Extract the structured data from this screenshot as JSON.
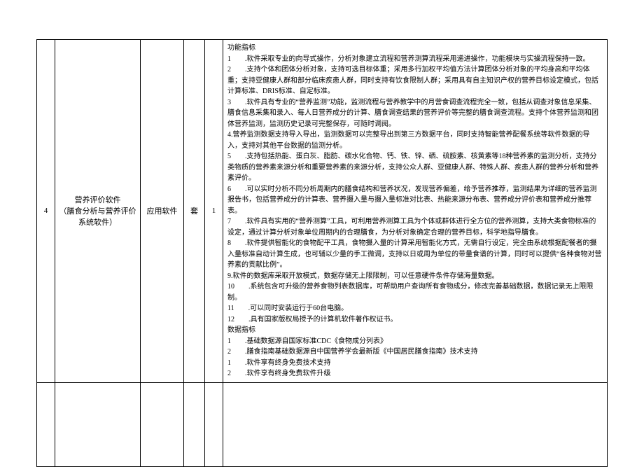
{
  "row": {
    "index": "4",
    "name": "营养评价软件\n（膳食分析与营养评价系统软件）",
    "type": "应用软件",
    "unit": "套",
    "qty": "1"
  },
  "details": {
    "funcTitle": "功能指标",
    "lines": [
      "1　　.软件采取专业的向导式操作，分析对象建立流程和营养测算流程采用递进操作，功能模块与实操流程保持一致。",
      "2　　.支持个体和团体分析对象，支持可选目标体重；采用多行加权平均值方法计算团体分析对象的平均身高和平均体重；支持亚健康人群和部分临床疾患人群，同时支持有饮食限制人群；采用具有自主知识产权的营养目标设定模式，包括计算标准、DRIS标准、自定标准。",
      "3　　.软件具有专业的“营养监测”功能，监测流程与营养教学中的月营食调查流程完全一致，包括从调查对象信息采集、膳食信息采集和录入、每人日营养成分的计算、膳食调查结果的营养评价等完整的膳食调查流程。支持个体营养监测和团体营养监测，监测历史记录可完整保存，可随时调阅。",
      "4.营养监测数据支持导入导出，监测数据可以完整导出到第三方数据平台，同时支持智能营养配餐系统等软件数据的导入，支持对其他平台数据的监测分析。",
      "5　　.支持包括热能、蛋白灰、脂肪、碳水化合物、钙、铁、锌、硒、硫胺素、核黄素等18种营养素的监测分析，支持分类物质的营养素来源分析和重要营养素的来源分析，支持公众人群、亚健康人群、特殊人群、疾患人群的营养分析和营养素评价。",
      "6　　.可以实时分析不同分析周期内的膳食结构和营养状况，发现营养偏差，给予营养推荐，监测结果为详细的营养监测报告书，包括营养成分的计算表、营养摄入量与摄入量标准对比表、热能来源分布表、营养成分评价表和营养成分推荐表。",
      "7　　.软件具有实用的“营养测算”工具，可利用营养测算工具为个体或群体进行全方位的营养测算，支持大类食物标准的设定，通过计算分析对象单位周期内的合理膳食，为分析对象确定合理的营养目标，科学地指导膳食。",
      "8　　.软件提供智能化的食物配平工具，食物摄入量的计算采用智能化方式，无需自行设定，完全由系统根据配餐者的摄入量标准自动计算生成，也可辅以少量的手工微调，支持以日或周为单位的带量食谱的计算，同时可以提供“各种食物对营养素的贡献比例”。",
      "9.软件的数据库采取开放模式，数据存储无上限限制，可以任意硬件条件存储海量数据。",
      "10　　.系统包含可升级的营养食物列表数据库，可帮助用户查询所有食物成分，修改完善基础数据，数据记录无上限限制。",
      "11　　.可以同时安装运行于60台电脑。",
      "12　　.具有国家版权局授予的计算机软件著作权证书。"
    ],
    "dataTitle": "数据指标",
    "dataLines": [
      "1　　.基础数据源自国家标准CDC《食物成分列表》",
      "2　　.膳食指南基础数据源自中国营养学会最新版《中国居民膳食指南》技术支持",
      "1　　.软件享有终身免费技术支持",
      "2　　.软件享有终身免费软件升级"
    ]
  }
}
